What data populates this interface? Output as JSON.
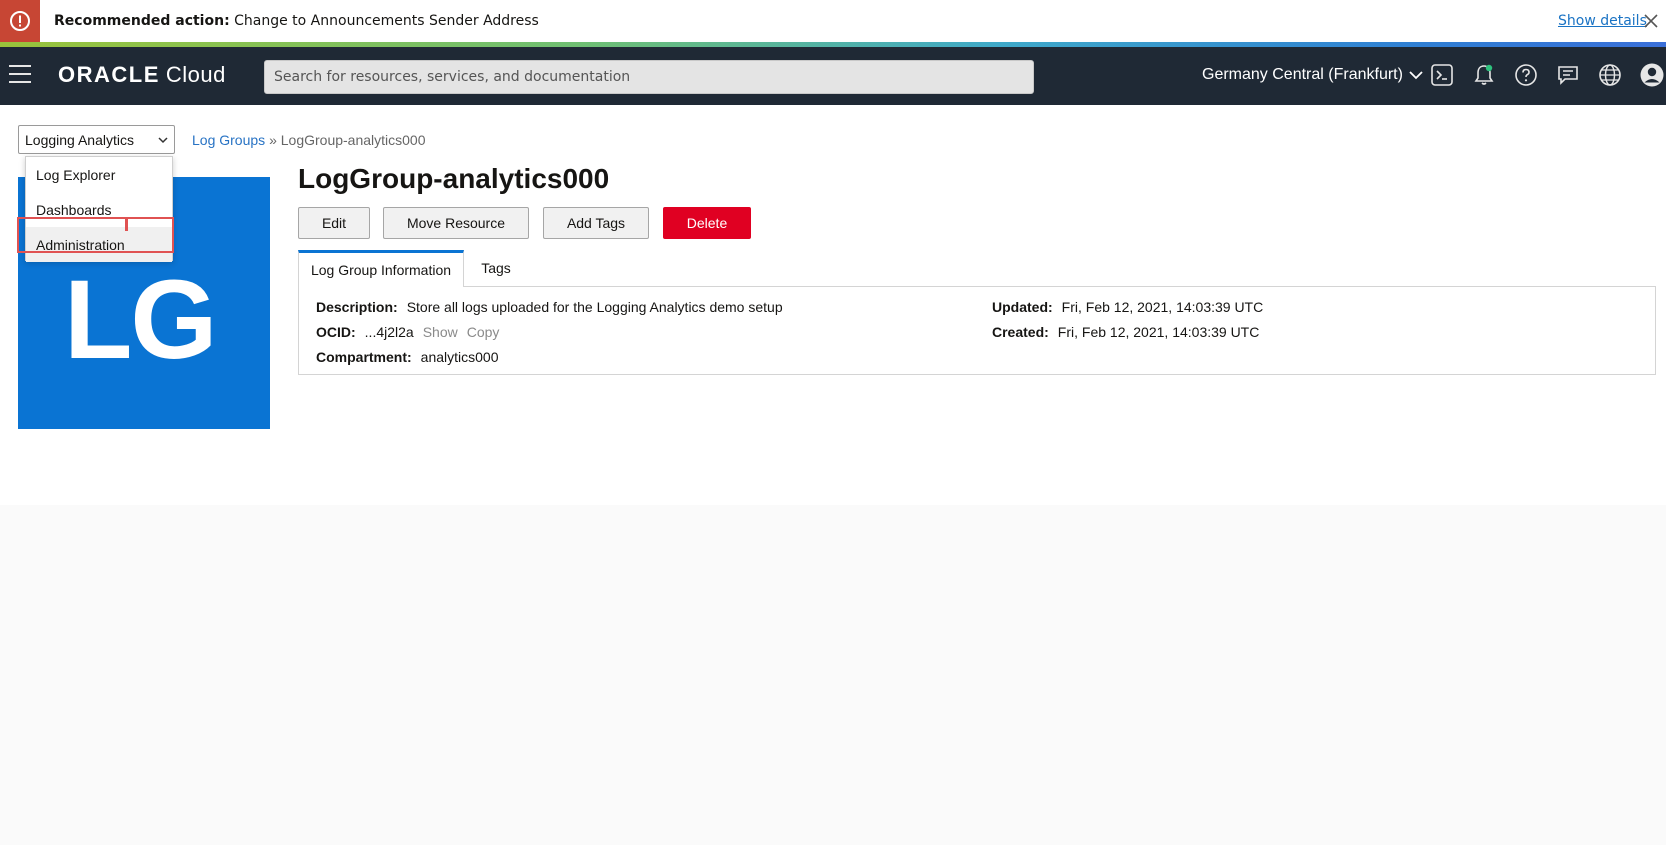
{
  "banner": {
    "label": "Recommended action:",
    "message": "Change to Announcements Sender Address",
    "link": "Show details",
    "icon": "alert-icon",
    "color": "#c74634"
  },
  "header": {
    "logo_brand": "ORACLE",
    "logo_product": "Cloud",
    "search_placeholder": "Search for resources, services, and documentation",
    "region": "Germany Central (Frankfurt)",
    "icons": [
      "cloud-shell-icon",
      "bell-icon",
      "help-icon",
      "chat-icon",
      "globe-icon",
      "profile-icon"
    ],
    "background": "#1f2935"
  },
  "service_menu": {
    "selected": "Logging Analytics",
    "items": [
      "Log Explorer",
      "Dashboards",
      "Administration"
    ]
  },
  "breadcrumb": {
    "parent": "Log Groups",
    "separator": "»",
    "current": "LogGroup-analytics000"
  },
  "tile": {
    "text": "LG",
    "color": "#0a74d3"
  },
  "page": {
    "title": "LogGroup-analytics000",
    "buttons": {
      "edit": "Edit",
      "move": "Move Resource",
      "tags": "Add Tags",
      "delete": "Delete"
    },
    "delete_color": "#e00022",
    "tabs": [
      "Log Group Information",
      "Tags"
    ],
    "info": {
      "description_label": "Description:",
      "description_value": "Store all logs uploaded for the Logging Analytics demo setup",
      "ocid_label": "OCID:",
      "ocid_value": "...4j2l2a",
      "ocid_show": "Show",
      "ocid_copy": "Copy",
      "compartment_label": "Compartment:",
      "compartment_value": "analytics000",
      "updated_label": "Updated:",
      "updated_value": "Fri, Feb 12, 2021, 14:03:39 UTC",
      "created_label": "Created:",
      "created_value": "Fri, Feb 12, 2021, 14:03:39 UTC"
    }
  }
}
